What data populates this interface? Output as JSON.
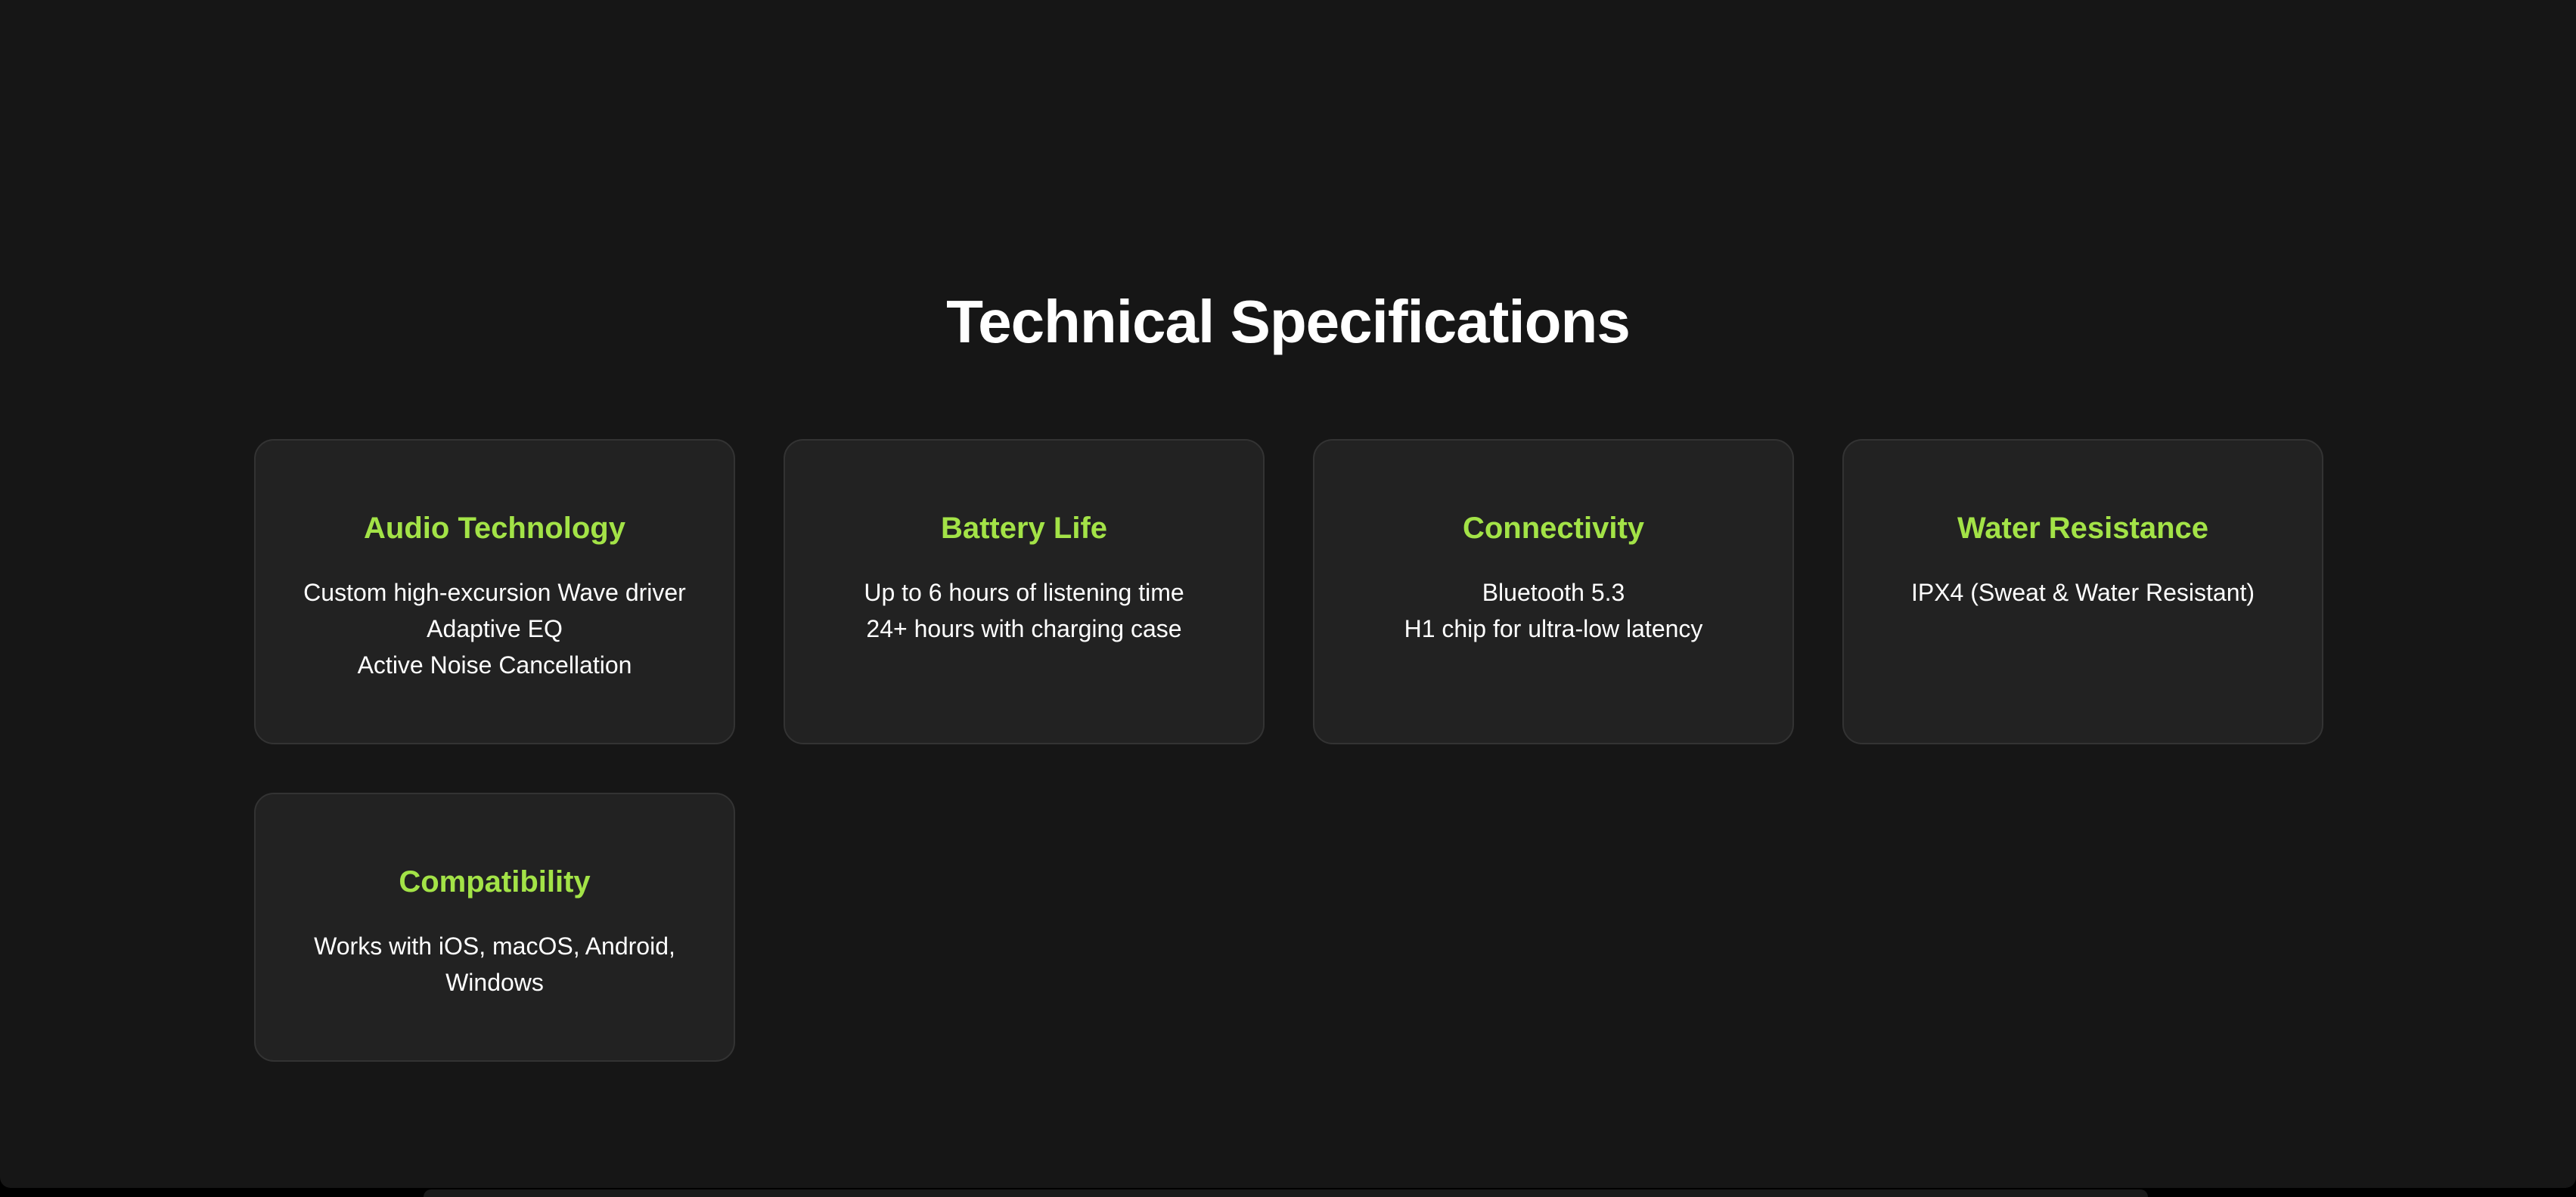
{
  "section": {
    "title": "Technical Specifications"
  },
  "cards": [
    {
      "title": "Audio Technology",
      "lines": [
        "Custom high-excursion Wave driver",
        "Adaptive EQ",
        "Active Noise Cancellation"
      ]
    },
    {
      "title": "Battery Life",
      "lines": [
        "Up to 6 hours of listening time",
        "24+ hours with charging case"
      ]
    },
    {
      "title": "Connectivity",
      "lines": [
        "Bluetooth 5.3",
        "H1 chip for ultra-low latency"
      ]
    },
    {
      "title": "Water Resistance",
      "lines": [
        "IPX4 (Sweat & Water Resistant)"
      ]
    },
    {
      "title": "Compatibility",
      "lines": [
        "Works with iOS, macOS, Android, Windows"
      ]
    }
  ],
  "colors": {
    "page_background": "#161616",
    "card_background": "#222222",
    "card_border": "#333333",
    "accent": "#a3e347",
    "text": "#ffffff"
  }
}
